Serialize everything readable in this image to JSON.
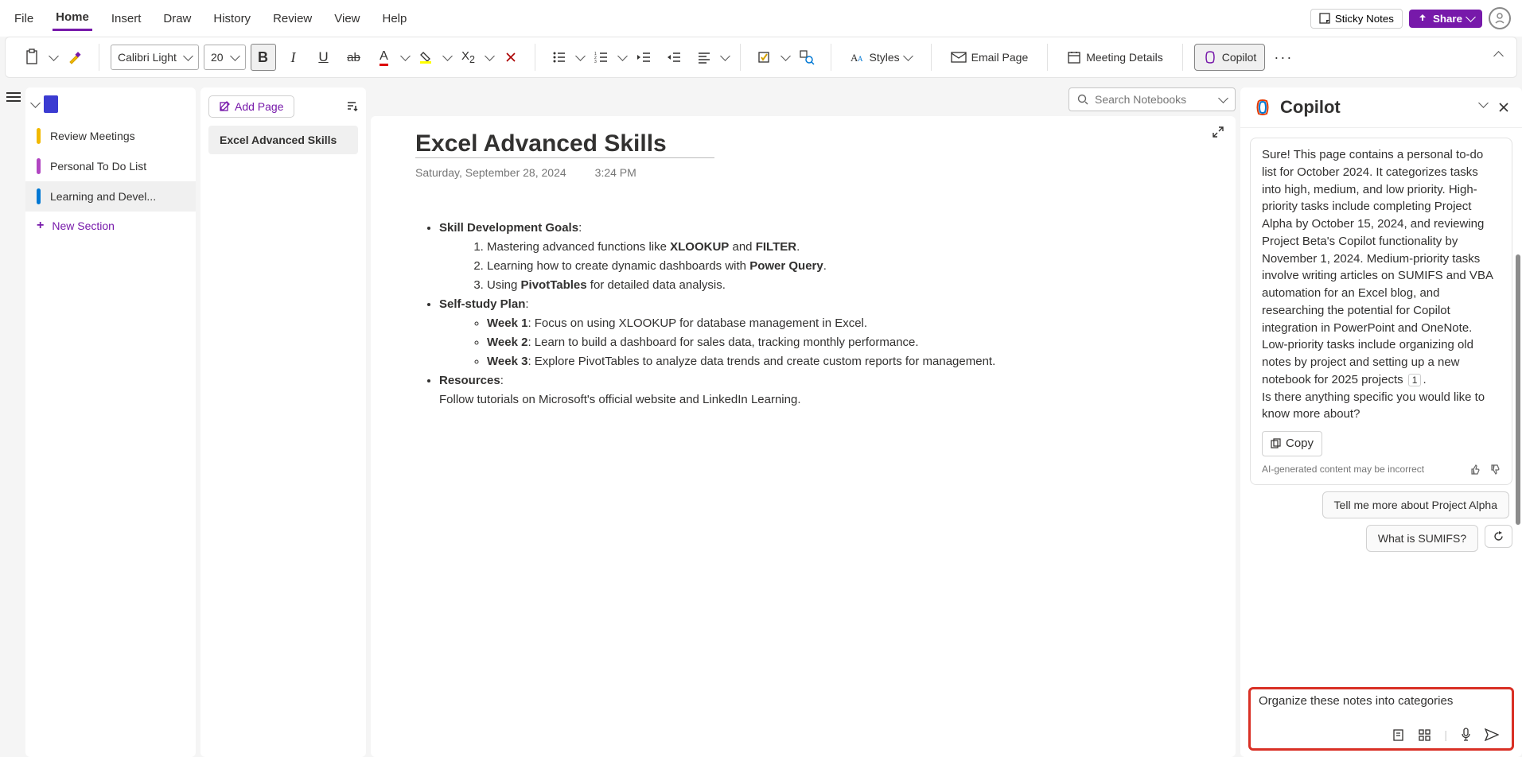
{
  "menus": [
    "File",
    "Home",
    "Insert",
    "Draw",
    "History",
    "Review",
    "View",
    "Help"
  ],
  "active_menu": 1,
  "top_right": {
    "sticky": "Sticky Notes",
    "share": "Share"
  },
  "ribbon": {
    "font_name": "Calibri Light",
    "font_size": "20",
    "styles": "Styles",
    "email": "Email Page",
    "meeting": "Meeting Details",
    "copilot": "Copilot"
  },
  "search_placeholder": "Search Notebooks",
  "sidebar": {
    "items": [
      {
        "label": "Review Meetings",
        "color": "#f2b900"
      },
      {
        "label": "Personal To Do List",
        "color": "#b146c2"
      },
      {
        "label": "Learning and Devel...",
        "color": "#0078d4"
      }
    ],
    "new_section": "New Section"
  },
  "pages": {
    "add": "Add Page",
    "items": [
      "Excel Advanced Skills"
    ],
    "selected": 0
  },
  "note": {
    "title": "Excel Advanced Skills",
    "date": "Saturday, September 28, 2024",
    "time": "3:24 PM",
    "h1": "Skill Development Goals",
    "goals_pre": [
      "Mastering advanced functions like ",
      "Learning how to create dynamic dashboards with ",
      "Using "
    ],
    "goals_bold": [
      "XLOOKUP",
      "FILTER",
      "Power Query",
      "PivotTables"
    ],
    "goals_mid": " and ",
    "goals_post": [
      ".",
      ".",
      " for detailed data analysis."
    ],
    "h2": "Self-study Plan",
    "weeks": [
      {
        "b": "Week 1",
        "t": ": Focus on using XLOOKUP for database management in Excel."
      },
      {
        "b": "Week 2",
        "t": ": Learn to build a dashboard for sales data, tracking monthly performance."
      },
      {
        "b": "Week 3",
        "t": ": Explore PivotTables to analyze data trends and create custom reports for management."
      }
    ],
    "h3": "Resources",
    "res": "Follow tutorials on Microsoft's official website and LinkedIn Learning."
  },
  "copilot": {
    "title": "Copilot",
    "message": "Sure! This page contains a personal to-do list for October 2024. It categorizes tasks into high, medium, and low priority. High-priority tasks include completing Project Alpha by October 15, 2024, and reviewing Project Beta's Copilot functionality by November 1, 2024. Medium-priority tasks involve writing articles on SUMIFS and VBA automation for an Excel blog, and researching the potential for Copilot integration in PowerPoint and OneNote. Low-priority tasks include organizing old notes by project and setting up a new notebook for 2025 projects",
    "ref": "1",
    "followup": "Is there anything specific you would like to know more about?",
    "copy": "Copy",
    "disclaimer": "AI-generated content may be incorrect",
    "suggestions": [
      "Tell me more about Project Alpha",
      "What is SUMIFS?"
    ],
    "input": "Organize these notes into categories"
  }
}
